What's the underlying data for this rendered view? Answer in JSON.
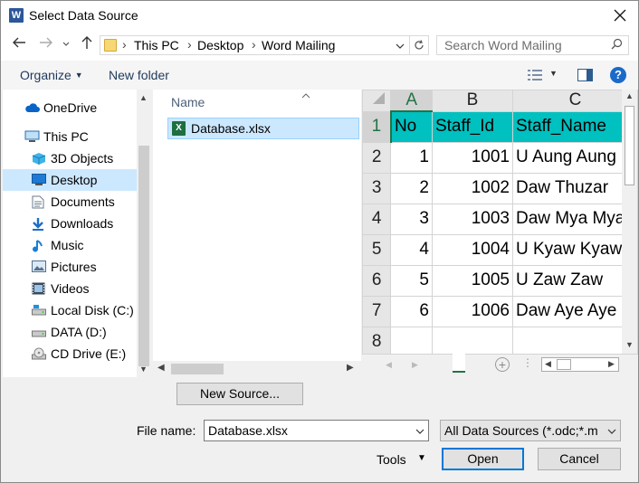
{
  "window": {
    "title": "Select Data Source",
    "app_icon": "W"
  },
  "nav": {
    "breadcrumbs": [
      "This PC",
      "Desktop",
      "Word Mailing"
    ],
    "search_placeholder": "Search Word Mailing"
  },
  "toolbar": {
    "organize_label": "Organize",
    "new_folder_label": "New folder"
  },
  "sidebar": {
    "items": [
      {
        "label": "OneDrive",
        "icon": "cloud-icon"
      },
      {
        "label": "This PC",
        "icon": "computer-icon"
      },
      {
        "label": "3D Objects",
        "icon": "cube-icon"
      },
      {
        "label": "Desktop",
        "icon": "desktop-icon",
        "selected": true
      },
      {
        "label": "Documents",
        "icon": "document-icon"
      },
      {
        "label": "Downloads",
        "icon": "download-icon"
      },
      {
        "label": "Music",
        "icon": "music-icon"
      },
      {
        "label": "Pictures",
        "icon": "pictures-icon"
      },
      {
        "label": "Videos",
        "icon": "video-icon"
      },
      {
        "label": "Local Disk (C:)",
        "icon": "drive-icon"
      },
      {
        "label": "DATA (D:)",
        "icon": "drive-icon"
      },
      {
        "label": "CD Drive (E:)",
        "icon": "cd-icon"
      }
    ]
  },
  "files": {
    "column_name": "Name",
    "items": [
      {
        "name": "Database.xlsx",
        "icon": "excel-icon"
      }
    ]
  },
  "preview": {
    "col_headers": [
      "A",
      "B",
      "C"
    ],
    "row_numbers": [
      "1",
      "2",
      "3",
      "4",
      "5",
      "6",
      "7",
      "8"
    ],
    "header": [
      "No",
      "Staff_Id",
      "Staff_Name"
    ],
    "rows": [
      [
        "1",
        "1001",
        "U Aung Aung"
      ],
      [
        "2",
        "1002",
        "Daw Thuzar"
      ],
      [
        "3",
        "1003",
        "Daw Mya Mya"
      ],
      [
        "4",
        "1004",
        "U Kyaw Kyaw"
      ],
      [
        "5",
        "1005",
        "U Zaw Zaw"
      ],
      [
        "6",
        "1006",
        "Daw Aye Aye"
      ]
    ],
    "header_color": "#00c0c0"
  },
  "footer": {
    "new_source_label": "New Source...",
    "file_name_label": "File name:",
    "file_name_value": "Database.xlsx",
    "file_type_value": "All Data Sources (*.odc;*.m",
    "tools_label": "Tools",
    "open_label": "Open",
    "cancel_label": "Cancel"
  }
}
